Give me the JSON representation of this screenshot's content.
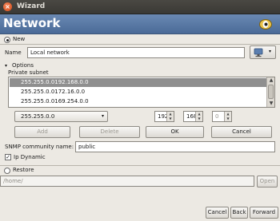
{
  "window": {
    "title": "Wizard",
    "close_glyph": "×"
  },
  "header": {
    "title": "Network",
    "icon": "network-eye-icon"
  },
  "new_section": {
    "radio_label": "New",
    "selected": true,
    "name_label": "Name",
    "name_value": "Local network",
    "icon_picker": "network-icon",
    "icon_picker_arrow": "▾",
    "options_label": "Options",
    "options_expander": "▾",
    "private_subnet_label": "Private subnet",
    "subnets": [
      {
        "mask": "255.255.0.0",
        "address": "192.168.0.0",
        "selected": true
      },
      {
        "mask": "255.255.0.0",
        "address": "172.16.0.0",
        "selected": false
      },
      {
        "mask": "255.255.0.0",
        "address": "169.254.0.0",
        "selected": false
      }
    ],
    "mask_combo": {
      "value": "255.255.0.0",
      "arrow": "▾"
    },
    "octets": [
      {
        "value": "192"
      },
      {
        "value": "168"
      },
      {
        "value": "0",
        "disabled": true
      }
    ],
    "spin_up": "▲",
    "spin_down": "▼",
    "buttons": {
      "add": "Add",
      "delete": "Delete",
      "ok": "OK",
      "cancel": "Cancel"
    },
    "snmp_label": "SNMP community name:",
    "snmp_value": "public",
    "ip_dynamic_label": "Ip Dynamic",
    "ip_dynamic_checked": true,
    "check_glyph": "✓"
  },
  "restore_section": {
    "radio_label": "Restore",
    "selected": false,
    "path_value": "/home/",
    "open_label": "Open"
  },
  "footer": {
    "cancel": "Cancel",
    "back": "Back",
    "forward": "Forward"
  }
}
